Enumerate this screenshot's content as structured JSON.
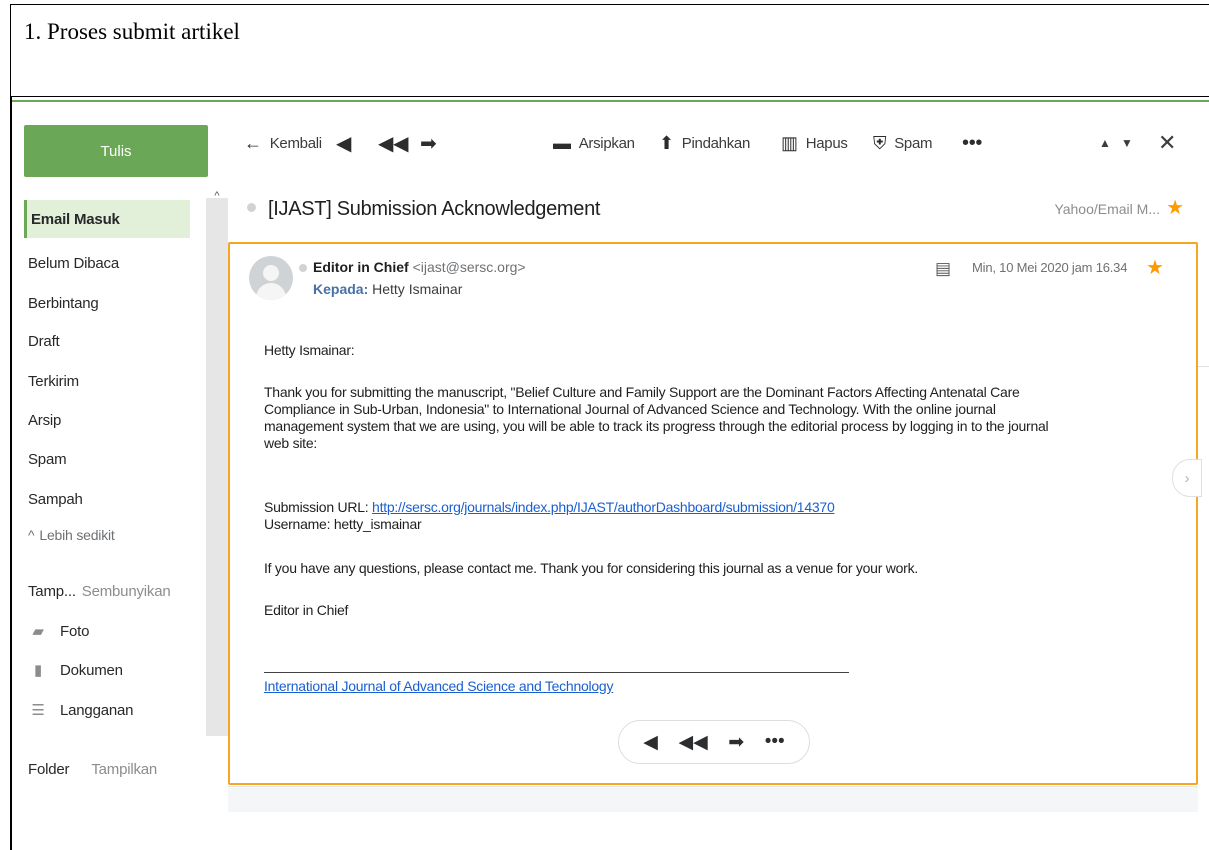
{
  "document": {
    "title": "1. Proses submit artikel"
  },
  "sidebar": {
    "compose_label": "Tulis",
    "items": [
      {
        "label": "Email Masuk"
      },
      {
        "label": "Belum Dibaca"
      },
      {
        "label": "Berbintang"
      },
      {
        "label": "Draft"
      },
      {
        "label": "Terkirim"
      },
      {
        "label": "Arsip"
      },
      {
        "label": "Spam"
      },
      {
        "label": "Sampah"
      }
    ],
    "less_label": "Lebih sedikit",
    "views_label": "Tamp...",
    "views_hide": "Sembunyikan",
    "views": [
      {
        "label": "Foto",
        "icon": "photo-icon"
      },
      {
        "label": "Dokumen",
        "icon": "document-icon"
      },
      {
        "label": "Langganan",
        "icon": "subscription-icon"
      }
    ],
    "folder_label": "Folder",
    "folder_show": "Tampilkan"
  },
  "toolbar": {
    "back_label": "Kembali",
    "archive_label": "Arsipkan",
    "move_label": "Pindahkan",
    "delete_label": "Hapus",
    "spam_label": "Spam"
  },
  "message": {
    "subject": "[IJAST] Submission Acknowledgement",
    "folder": "Yahoo/Email M...",
    "sender_name": "Editor in Chief",
    "sender_email": "<ijast@sersc.org>",
    "to_label": "Kepada:",
    "to_name": "Hetty Ismainar",
    "date": "Min, 10 Mei 2020 jam 16.34",
    "greeting": "Hetty Ismainar:",
    "paragraph1_line1": "Thank you for submitting the manuscript, \"Belief Culture and Family Support are the Dominant Factors Affecting Antenatal Care",
    "paragraph1_line2": "Compliance in Sub-Urban, Indonesia\" to International Journal of Advanced Science and Technology. With the online journal",
    "paragraph1_line3": "management system that we are using, you will be able to track its progress through the editorial process by logging in to the journal",
    "paragraph1_line4": "web site:",
    "submission_label": "Submission URL:",
    "submission_url": "http://sersc.org/journals/index.php/IJAST/authorDashboard/submission/14370",
    "username_line": "Username: hetty_ismainar",
    "paragraph2": "If you have any questions, please contact me. Thank you for considering this journal as a venue for your work.",
    "signature": "Editor in Chief",
    "journal_link": "International Journal of Advanced Science and Technology"
  },
  "colors": {
    "accent_green": "#6aa857",
    "card_border": "#f5a623",
    "star": "#ff9a00",
    "link": "#1a5fd1"
  }
}
